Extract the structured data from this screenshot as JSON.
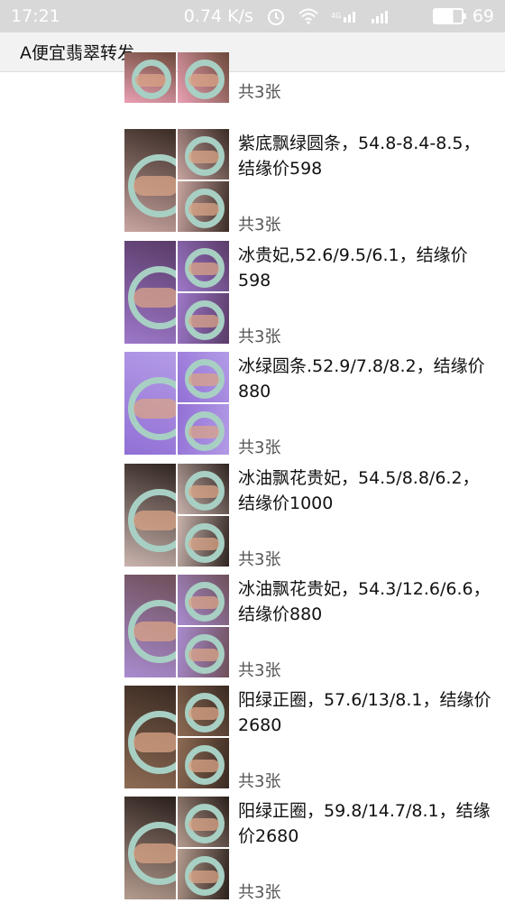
{
  "status_bar": {
    "time": "17:21",
    "speed": "0.74 K/s",
    "battery": "69"
  },
  "app_bar": {
    "title": "A便宜翡翠转发"
  },
  "posts": [
    {
      "caption": "",
      "count": "共3张",
      "colors": {
        "bg": "#e9a0b4",
        "accent": "#6d4a3a"
      }
    },
    {
      "caption": "紫底飘绿圆条，54.8-8.4-8.5，结缘价598",
      "count": "共3张",
      "colors": {
        "bg": "#c8a4a0",
        "accent": "#3a2b25"
      }
    },
    {
      "caption": "冰贵妃,52.6/9.5/6.1，结缘价598",
      "count": "共3张",
      "colors": {
        "bg": "#9d78c9",
        "accent": "#5a3b68"
      }
    },
    {
      "caption": "冰绿圆条.52.9/7.8/8.2，结缘价880",
      "count": "共3张",
      "colors": {
        "bg": "#9270d6",
        "accent": "#b39be6"
      }
    },
    {
      "caption": "冰油飘花贵妃，54.5/8.8/6.2，结缘价1000",
      "count": "共3张",
      "colors": {
        "bg": "#c9b3ad",
        "accent": "#2f2420"
      }
    },
    {
      "caption": "冰油飘花贵妃，54.3/12.6/6.6，结缘价880",
      "count": "共3张",
      "colors": {
        "bg": "#a98bcf",
        "accent": "#6e4f59"
      }
    },
    {
      "caption": "阳绿正圈，57.6/13/8.1，结缘价2680",
      "count": "共3张",
      "colors": {
        "bg": "#8d6b54",
        "accent": "#3a2a22"
      }
    },
    {
      "caption": "阳绿正圈，59.8/14.7/8.1，结缘价2680",
      "count": "共3张",
      "colors": {
        "bg": "#b49b8e",
        "accent": "#2a1f1b"
      }
    }
  ]
}
